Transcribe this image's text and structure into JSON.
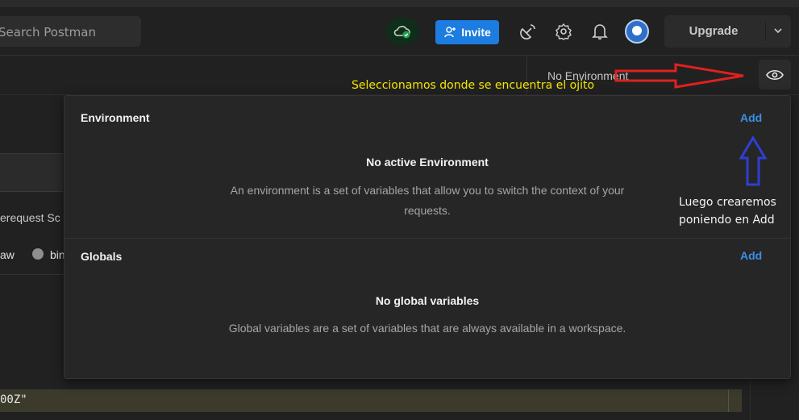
{
  "header": {
    "search_placeholder": "Search Postman",
    "invite_label": "Invite",
    "upgrade_label": "Upgrade"
  },
  "environment_bar": {
    "selected_environment": "No Environment"
  },
  "popover": {
    "environment": {
      "title": "Environment",
      "add_label": "Add",
      "empty_title": "No active Environment",
      "empty_description": "An environment is a set of variables that allow you to switch the context of your requests."
    },
    "globals": {
      "title": "Globals",
      "add_label": "Add",
      "empty_title": "No global variables",
      "empty_description": "Global variables are a set of variables that are always available in a workspace."
    }
  },
  "background": {
    "prerequest_fragment": "erequest Sc",
    "raw_fragment": "aw",
    "binary_fragment": "bin",
    "code_fragment": "00Z\""
  },
  "annotations": {
    "eye_note": "Seleccionamos donde se encuentra el ojito",
    "add_note": "Luego crearemos poniendo en Add"
  },
  "colors": {
    "accent_blue": "#1c7ce0",
    "link_blue": "#3b8ee8",
    "annotation_yellow": "#f2e600",
    "arrow_red": "#e02020",
    "arrow_blue": "#2f3fd0"
  },
  "icons": [
    "cloud-sync-icon",
    "user-plus-icon",
    "satellite-icon",
    "gear-icon",
    "bell-icon",
    "avatar",
    "chevron-down-icon",
    "eye-icon"
  ]
}
